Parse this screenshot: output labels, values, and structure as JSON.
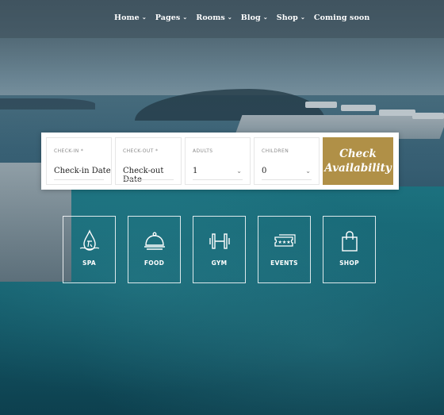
{
  "nav": {
    "items": [
      {
        "label": "Home",
        "has_dropdown": true
      },
      {
        "label": "Pages",
        "has_dropdown": true
      },
      {
        "label": "Rooms",
        "has_dropdown": true
      },
      {
        "label": "Blog",
        "has_dropdown": true
      },
      {
        "label": "Shop",
        "has_dropdown": true
      },
      {
        "label": "Coming soon",
        "has_dropdown": false
      }
    ],
    "dropdown_glyph": "⌄"
  },
  "booking": {
    "checkin": {
      "label": "CHECK-IN *",
      "value": "Check-in Date"
    },
    "checkout": {
      "label": "CHECK-OUT *",
      "value": "Check-out Date"
    },
    "adults": {
      "label": "ADULTS",
      "value": "1"
    },
    "children": {
      "label": "CHILDREN",
      "value": "0"
    },
    "submit_label": "Check\nAvailability",
    "accent_color": "#b09047"
  },
  "amenities": [
    {
      "label": "SPA",
      "icon": "spa-drop-icon"
    },
    {
      "label": "FOOD",
      "icon": "food-cloche-icon"
    },
    {
      "label": "GYM",
      "icon": "dumbbell-icon"
    },
    {
      "label": "EVENTS",
      "icon": "tickets-icon"
    },
    {
      "label": "SHOP",
      "icon": "shopping-bag-icon"
    }
  ]
}
